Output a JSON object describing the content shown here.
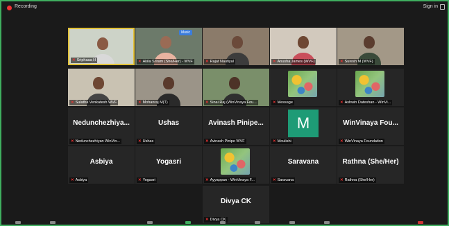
{
  "topbar": {
    "recording_label": "Recording",
    "signin_label": "Sign in"
  },
  "colors": {
    "active_speaker": "#e2c23a",
    "avatar_bg": "#1e9b76",
    "frame_border": "#3fae5f",
    "recording": "#ee3333"
  },
  "tiles": [
    {
      "kind": "video",
      "label": "Sriphaaa H",
      "active": true
    },
    {
      "kind": "video",
      "label": "Akila Sriram (She/Her) - WVF",
      "badge": "Music"
    },
    {
      "kind": "video",
      "label": "Rajat Nautiyal"
    },
    {
      "kind": "video",
      "label": "Anusha James (WVF)"
    },
    {
      "kind": "video",
      "label": "Suresh M (WVF)"
    },
    {
      "kind": "video",
      "label": "Sulatha Venkatesh WVF"
    },
    {
      "kind": "video",
      "label": "Mohanraj M(T)"
    },
    {
      "kind": "video",
      "label": "Sinai Raj (WinVinaya Fou..."
    },
    {
      "kind": "art",
      "label": "Message"
    },
    {
      "kind": "art",
      "label": "Ashwin Dateshan - WinVi..."
    },
    {
      "kind": "name",
      "name": "Nedunchezhiya...",
      "label": "Nedunchezhiyan WinVin..."
    },
    {
      "kind": "name",
      "name": "Ushas",
      "label": "Ushas"
    },
    {
      "kind": "name",
      "name": "Avinash Pinipe...",
      "label": "Avinash Pinipe WVF"
    },
    {
      "kind": "avatar",
      "letter": "M",
      "label": "Moulishi"
    },
    {
      "kind": "name",
      "name": "WinVinaya Fou...",
      "label": "WinVinaya Foundation"
    },
    {
      "kind": "name",
      "name": "Asbiya",
      "label": "Asbiya"
    },
    {
      "kind": "name",
      "name": "Yogasri",
      "label": "Yogasri"
    },
    {
      "kind": "art",
      "label": "Ayyappan - WinVinaya F..."
    },
    {
      "kind": "name",
      "name": "Saravana",
      "label": "Saravana"
    },
    {
      "kind": "name",
      "name": "Rathna (She/Her)",
      "label": "Rathna (She/Her)"
    },
    {
      "kind": "name",
      "name": "Divya CK",
      "label": "Divya CK"
    }
  ]
}
